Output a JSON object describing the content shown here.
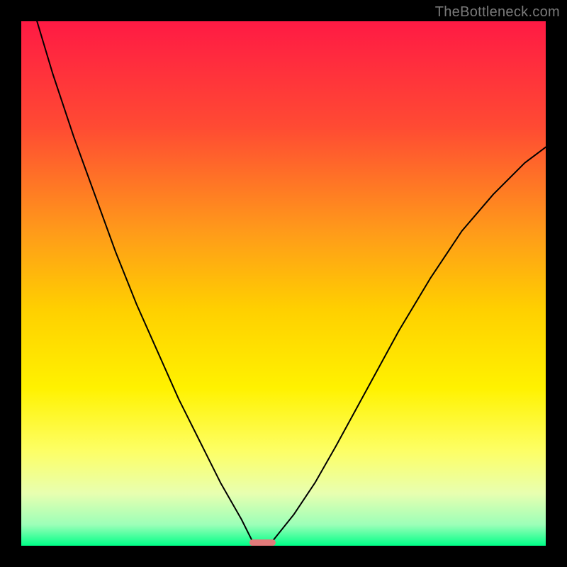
{
  "watermark": "TheBottleneck.com",
  "chart_data": {
    "type": "line",
    "title": "",
    "xlabel": "",
    "ylabel": "",
    "xlim": [
      0,
      100
    ],
    "ylim": [
      0,
      100
    ],
    "grid": false,
    "legend": false,
    "gradient_stops": [
      {
        "offset": 0.0,
        "color": "#ff1a44"
      },
      {
        "offset": 0.2,
        "color": "#ff4a33"
      },
      {
        "offset": 0.4,
        "color": "#ff9a1a"
      },
      {
        "offset": 0.55,
        "color": "#ffd000"
      },
      {
        "offset": 0.7,
        "color": "#fff200"
      },
      {
        "offset": 0.82,
        "color": "#fdff66"
      },
      {
        "offset": 0.9,
        "color": "#e8ffb0"
      },
      {
        "offset": 0.96,
        "color": "#9cffb8"
      },
      {
        "offset": 1.0,
        "color": "#00ff88"
      }
    ],
    "series": [
      {
        "name": "left-branch",
        "x": [
          3,
          6,
          10,
          14,
          18,
          22,
          26,
          30,
          34,
          38,
          42,
          44
        ],
        "y": [
          100,
          90,
          78,
          67,
          56,
          46,
          37,
          28,
          20,
          12,
          5,
          1
        ]
      },
      {
        "name": "right-branch",
        "x": [
          48,
          52,
          56,
          60,
          66,
          72,
          78,
          84,
          90,
          96,
          100
        ],
        "y": [
          1,
          6,
          12,
          19,
          30,
          41,
          51,
          60,
          67,
          73,
          76
        ]
      }
    ],
    "marker": {
      "name": "trough-marker",
      "x": 46,
      "y": 0,
      "width_pct": 5,
      "height_pct": 1.2,
      "color": "#e27a7a"
    }
  }
}
